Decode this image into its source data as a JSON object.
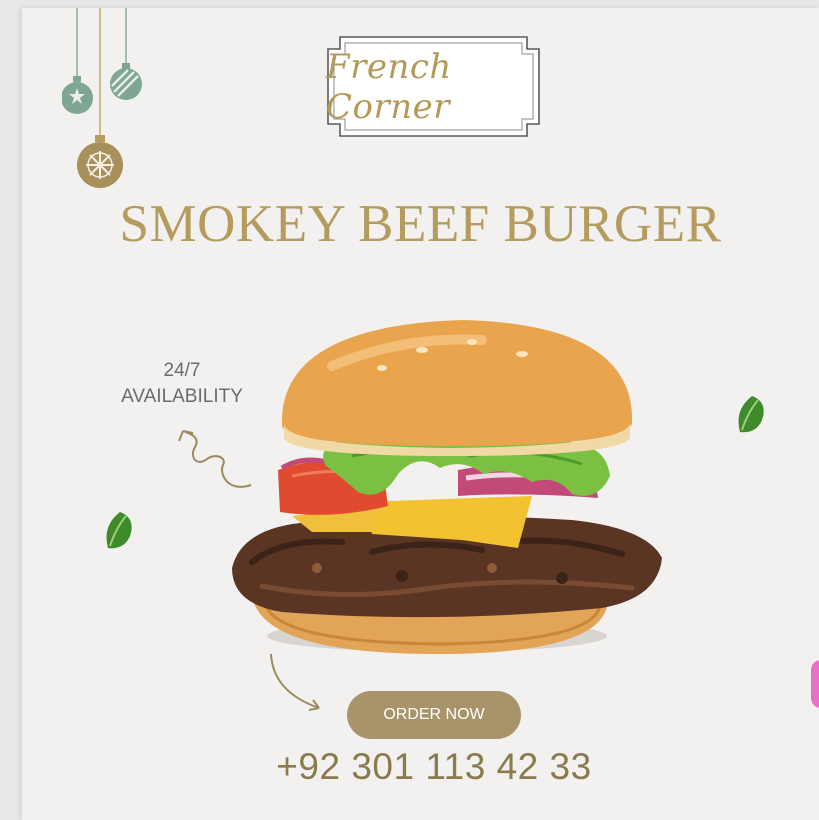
{
  "brand": {
    "logo_text": "French Corner"
  },
  "headline": "SMOKEY BEEF BURGER",
  "availability": {
    "line1": "24/7",
    "line2": "AVAILABILITY"
  },
  "cta": {
    "label": "ORDER NOW"
  },
  "contact": {
    "phone": "+92 301 113 42 33"
  },
  "colors": {
    "gold": "#b39c5e",
    "button": "#a8946a",
    "ornament_green": "#7fa593",
    "background": "#f2f1ef"
  },
  "icons": [
    "ornament-bauble-icon",
    "ornament-striped-icon",
    "ornament-snowflake-icon",
    "leaf-icon",
    "curved-arrow-icon"
  ]
}
